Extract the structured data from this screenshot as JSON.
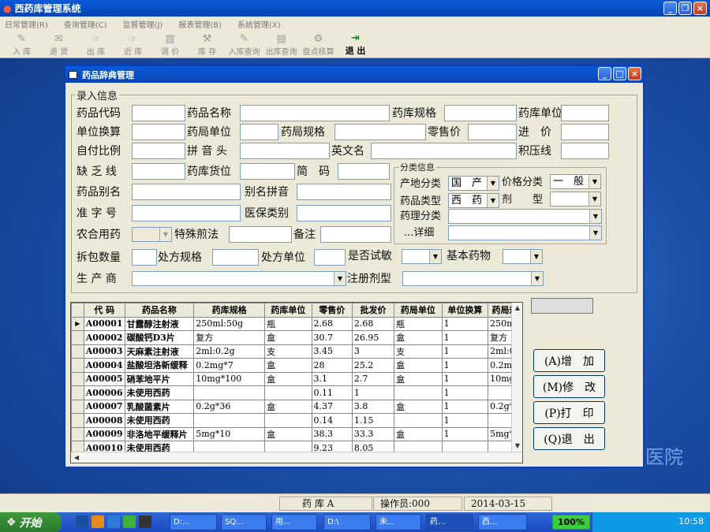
{
  "app": {
    "title": "西药库管理系统",
    "menu": [
      "日常管理(R)",
      "查询管理(C)",
      "监督管理(J)",
      "报表管理(B)",
      "系统管理(X)"
    ],
    "toolbar": [
      "入 库",
      "退 货",
      "出 库",
      "近 库",
      "调 价",
      "库 存",
      "入库查询",
      "出库查询",
      "盘点核算",
      "退 出"
    ]
  },
  "dialog": {
    "title": "药品辞典管理",
    "group_title": "录入信息",
    "labels": {
      "code": "药品代码",
      "name": "药品名称",
      "spec": "药库规格",
      "unit": "药库单位",
      "conv": "单位换算",
      "ju_unit": "药局单位",
      "ju_spec": "药局规格",
      "retail": "零售价",
      "purchase": "进　价",
      "selfpay": "自付比例",
      "pinyin": "拼 音 头",
      "english": "英文名",
      "overstock": "积压线",
      "shortage": "缺 乏 线",
      "location": "药库货位",
      "short_code": "简　码",
      "alias": "药品别名",
      "alias_pinyin": "别名拼音",
      "approval": "准 字 号",
      "insurance": "医保类别",
      "nhc": "农合用药",
      "decoct": "特殊煎法",
      "remark": "备注",
      "pack": "拆包数量",
      "rx_spec": "处方规格",
      "rx_unit": "处方单位",
      "skin_test": "是否试敏",
      "basic": "基本药物",
      "maker": "生 产 商",
      "reg_type": "注册剂型"
    },
    "classify": {
      "title": "分类信息",
      "origin_label": "产地分类",
      "origin_value": "国　产",
      "price_label": "价格分类",
      "price_value": "一　般",
      "type_label": "药品类型",
      "type_value": "西　药",
      "form_label": "剂　　型",
      "form_value": "",
      "pharm_label": "药理分类",
      "detail_label": "...详细"
    },
    "grid": {
      "headers": [
        "代 码",
        "药品名称",
        "药库规格",
        "药库单位",
        "零售价",
        "批发价",
        "药局单位",
        "单位换算",
        "药局规"
      ],
      "rows": [
        [
          "A00001",
          "甘露醇注射液",
          "250ml:50g",
          "瓶",
          "2.68",
          "2.68",
          "瓶",
          "1",
          "250m"
        ],
        [
          "A00002",
          "碳酸钙D3片",
          "复方",
          "盒",
          "30.7",
          "26.95",
          "盒",
          "1",
          "复方"
        ],
        [
          "A00003",
          "天麻素注射液",
          "2ml:0.2g",
          "支",
          "3.45",
          "3",
          "支",
          "1",
          "2ml:0"
        ],
        [
          "A00004",
          "盐酸坦洛新缓释",
          "0.2mg*7",
          "盒",
          "28",
          "25.2",
          "盒",
          "1",
          "0.2mg"
        ],
        [
          "A00005",
          "硝苯地平片",
          "10mg*100",
          "盒",
          "3.1",
          "2.7",
          "盒",
          "1",
          "10mg"
        ],
        [
          "A00006",
          "未使用西药",
          "",
          "",
          "0.11",
          "1",
          "",
          "1",
          ""
        ],
        [
          "A00007",
          "乳酸菌素片",
          "0.2g*36",
          "盒",
          "4.37",
          "3.8",
          "盒",
          "1",
          "0.2g*"
        ],
        [
          "A00008",
          "未使用西药",
          "",
          "",
          "0.14",
          "1.15",
          "",
          "1",
          ""
        ],
        [
          "A00009",
          "非洛地平缓释片",
          "5mg*10",
          "盒",
          "38.3",
          "33.3",
          "盒",
          "1",
          "5mg*"
        ],
        [
          "A00010",
          "未使用西药",
          "",
          "",
          "9.23",
          "8.05",
          "",
          "",
          ""
        ]
      ]
    },
    "buttons": {
      "add": "(A)增　加",
      "modify": "(M)修　改",
      "print": "(P)打　印",
      "exit": "(Q)退　出"
    }
  },
  "status": {
    "store": "药 库 A",
    "operator": "操作员:000",
    "date": "2014-03-15"
  },
  "taskbar": {
    "start": "开始",
    "tasks": [
      "D:...",
      "SQ...",
      "用...",
      "D:\\",
      "未...",
      "药...",
      "西..."
    ],
    "percent": "100%",
    "clock": "10:58"
  },
  "desktop_text": "医院"
}
